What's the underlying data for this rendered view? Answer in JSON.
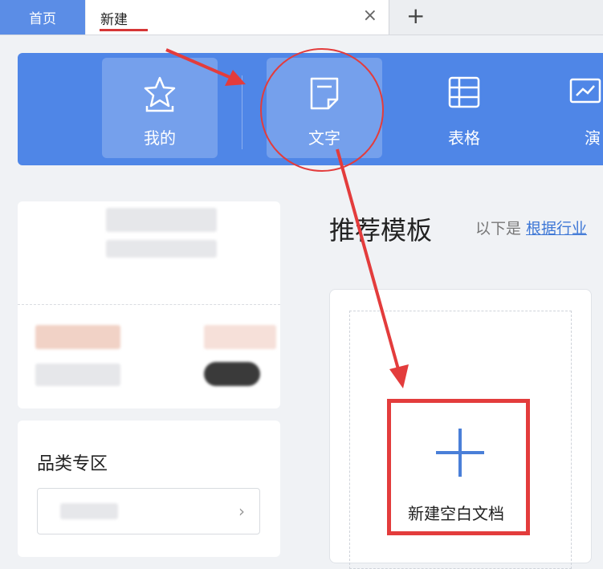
{
  "tabs": {
    "home": "首页",
    "active": "新建",
    "close_glyph": "×",
    "add_glyph": "+"
  },
  "categories": [
    {
      "label": "我的",
      "icon": "star-icon",
      "active": true
    },
    {
      "label": "文字",
      "icon": "document-icon",
      "active": true
    },
    {
      "label": "表格",
      "icon": "table-icon",
      "active": false
    },
    {
      "label": "演",
      "icon": "presentation-icon",
      "active": false
    }
  ],
  "main": {
    "heading": "推荐模板",
    "subtitle": "以下是",
    "subtitle_link": "根据行业",
    "new_blank": "新建空白文档"
  },
  "sidebar": {
    "category_heading": "品类专区",
    "chevron_glyph": "›"
  },
  "colors": {
    "band": "#4f86e7",
    "home_tab": "#5b8de6",
    "accent_red": "#e33c3c",
    "plus_blue": "#4a7fd8"
  }
}
